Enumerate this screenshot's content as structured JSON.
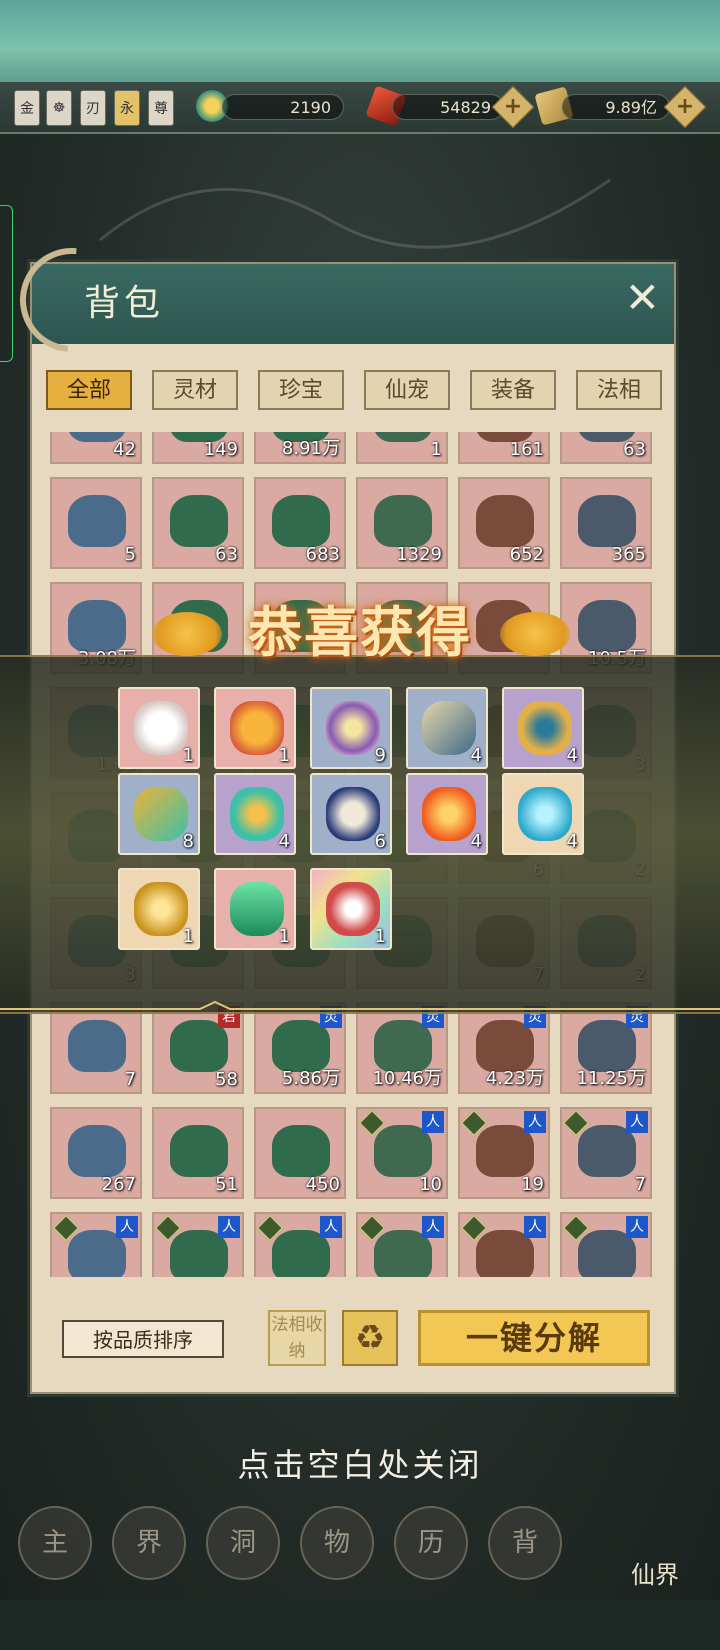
{
  "top_bar": {
    "rank_badges": [
      "金",
      "☸",
      "刃",
      "永",
      "尊"
    ],
    "resources": [
      {
        "name": "spirit-swirl-icon",
        "value": "2190"
      },
      {
        "name": "red-crystal-icon",
        "value": "54829"
      },
      {
        "name": "scroll-coin-icon",
        "value": "9.89亿"
      }
    ]
  },
  "panel": {
    "title": "背包",
    "categories": [
      "全部",
      "灵材",
      "珍宝",
      "仙宠",
      "装备",
      "法相"
    ],
    "active_category": "全部"
  },
  "inventory": [
    {
      "count": "42",
      "tag": ""
    },
    {
      "count": "149",
      "tag": ""
    },
    {
      "count": "8.91万",
      "tag": ""
    },
    {
      "count": "1",
      "tag": ""
    },
    {
      "count": "161",
      "tag": ""
    },
    {
      "count": "63",
      "tag": ""
    },
    {
      "count": "5",
      "tag": ""
    },
    {
      "count": "63",
      "tag": ""
    },
    {
      "count": "683",
      "tag": ""
    },
    {
      "count": "1329",
      "tag": ""
    },
    {
      "count": "652",
      "tag": ""
    },
    {
      "count": "365",
      "tag": ""
    },
    {
      "count": "3.08万",
      "tag": ""
    },
    {
      "count": "",
      "tag": ""
    },
    {
      "count": "",
      "tag": ""
    },
    {
      "count": "",
      "tag": ""
    },
    {
      "count": "",
      "tag": ""
    },
    {
      "count": "10.5万",
      "tag": ""
    },
    {
      "count": "1.65",
      "tag": ""
    },
    {
      "count": "",
      "tag": ""
    },
    {
      "count": "",
      "tag": ""
    },
    {
      "count": "",
      "tag": ""
    },
    {
      "count": "",
      "tag": ""
    },
    {
      "count": "3",
      "tag": ""
    },
    {
      "count": "",
      "tag": ""
    },
    {
      "count": "",
      "tag": ""
    },
    {
      "count": "",
      "tag": ""
    },
    {
      "count": "",
      "tag": ""
    },
    {
      "count": "6",
      "tag": ""
    },
    {
      "count": "2",
      "tag": ""
    },
    {
      "count": "3",
      "tag": ""
    },
    {
      "count": "",
      "tag": ""
    },
    {
      "count": "",
      "tag": ""
    },
    {
      "count": "",
      "tag": ""
    },
    {
      "count": "7",
      "tag": ""
    },
    {
      "count": "2",
      "tag": ""
    },
    {
      "count": "7",
      "tag": ""
    },
    {
      "count": "58",
      "tag": "君"
    },
    {
      "count": "5.86万",
      "tag": "灵"
    },
    {
      "count": "10.46万",
      "tag": "灵"
    },
    {
      "count": "4.23万",
      "tag": "灵"
    },
    {
      "count": "11.25万",
      "tag": "灵"
    },
    {
      "count": "267",
      "tag": ""
    },
    {
      "count": "51",
      "tag": ""
    },
    {
      "count": "450",
      "tag": ""
    },
    {
      "count": "10",
      "tag": "人"
    },
    {
      "count": "19",
      "tag": "人"
    },
    {
      "count": "7",
      "tag": "人"
    },
    {
      "count": "",
      "tag": "人"
    },
    {
      "count": "",
      "tag": "人"
    },
    {
      "count": "",
      "tag": "人"
    },
    {
      "count": "",
      "tag": "人"
    },
    {
      "count": "",
      "tag": "人"
    },
    {
      "count": "",
      "tag": "人"
    }
  ],
  "reward_popup": {
    "title": "恭喜获得",
    "items": [
      {
        "name": "jade-rabbit",
        "count": "1",
        "quality": "pink"
      },
      {
        "name": "golden-lion",
        "count": "1",
        "quality": "pink"
      },
      {
        "name": "star-flower",
        "count": "9",
        "quality": "blue"
      },
      {
        "name": "scroll",
        "count": "4",
        "quality": "blue"
      },
      {
        "name": "peacock-feather",
        "count": "4",
        "quality": "purple"
      },
      {
        "name": "hairpin",
        "count": "8",
        "quality": "blue"
      },
      {
        "name": "cloud-charm",
        "count": "4",
        "quality": "purple"
      },
      {
        "name": "porcelain-vase",
        "count": "6",
        "quality": "blue"
      },
      {
        "name": "fire-essence",
        "count": "4",
        "quality": "purple"
      },
      {
        "name": "spirit-bottle",
        "count": "4",
        "quality": "gold"
      },
      {
        "name": "gold-censer",
        "count": "1",
        "quality": "gold"
      },
      {
        "name": "jade-pillow",
        "count": "1",
        "quality": "pink"
      },
      {
        "name": "swallow-kite",
        "count": "1",
        "quality": "rainbow"
      }
    ]
  },
  "actions": {
    "sort_label": "按品质排序",
    "faxiang_label": "法相收纳",
    "decompose_label": "一键分解"
  },
  "hint": "点击空白处关闭",
  "bottom_nav": [
    "主",
    "界",
    "洞",
    "物",
    "历",
    "背",
    "仙界"
  ]
}
